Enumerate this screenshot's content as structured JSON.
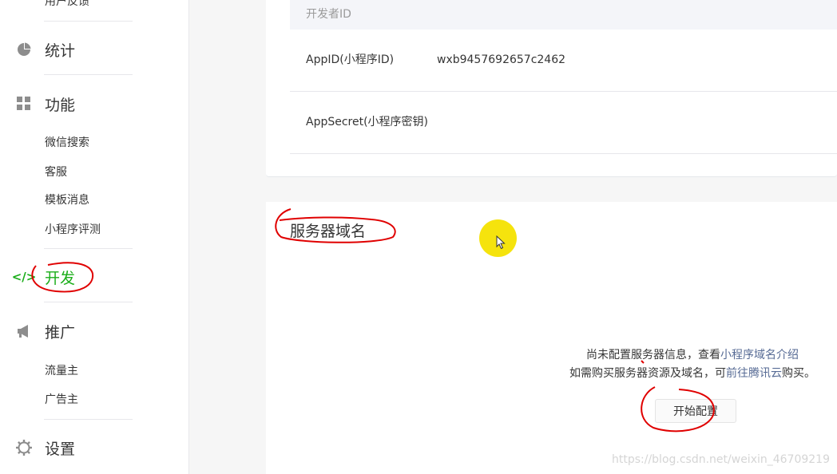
{
  "sidebar": {
    "top_item": "用户反馈",
    "sections": [
      {
        "label": "统计",
        "icon": "pie-chart-icon"
      },
      {
        "label": "功能",
        "icon": "grid-icon",
        "items": [
          "微信搜索",
          "客服",
          "模板消息",
          "小程序评测"
        ]
      },
      {
        "label": "开发",
        "icon": "code-icon",
        "active": true
      },
      {
        "label": "推广",
        "icon": "megaphone-icon",
        "items": [
          "流量主",
          "广告主"
        ]
      },
      {
        "label": "设置",
        "icon": "gear-icon"
      }
    ],
    "active_color": "#1aad19"
  },
  "developer": {
    "header": "开发者ID",
    "rows": [
      {
        "key": "AppID(小程序ID)",
        "value": "wxb9457692657c2462"
      },
      {
        "key": "AppSecret(小程序密钥)",
        "value": ""
      }
    ]
  },
  "server": {
    "title": "服务器域名",
    "line1_prefix": "尚未配置服务器信息，查看",
    "line1_link": "小程序域名介绍",
    "line2_prefix": "如需购买服务器资源及域名，可",
    "line2_link": "前往腾讯云",
    "line2_suffix": "购买。",
    "button": "开始配置",
    "link_color": "#576b95"
  },
  "watermark": "https://blog.csdn.net/weixin_46709219",
  "annotation_color": "#e00000"
}
